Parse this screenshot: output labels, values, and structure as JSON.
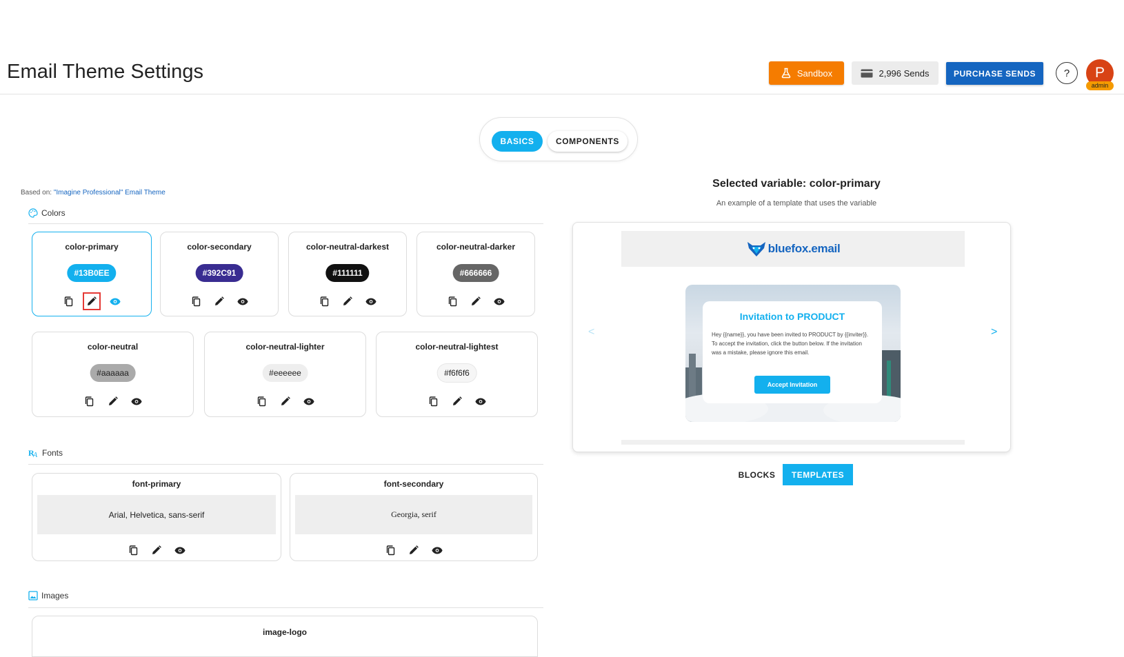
{
  "header": {
    "title": "Email Theme Settings",
    "sandbox_label": "Sandbox",
    "sends_label": "2,996 Sends",
    "purchase_label": "PURCHASE SENDS",
    "help_label": "?",
    "avatar_initial": "P",
    "role": "admin",
    "colors": {
      "sandbox": "#f57c00",
      "purchase": "#1565c0",
      "avatar": "#d84315"
    }
  },
  "tabs": [
    {
      "label": "BASICS",
      "active": true
    },
    {
      "label": "COMPONENTS",
      "active": false
    }
  ],
  "based_on": {
    "prefix": "Based on:",
    "theme": "\"Imagine Professional\" Email Theme"
  },
  "sections": {
    "colors": "Colors",
    "fonts": "Fonts",
    "images": "Images"
  },
  "color_vars": [
    {
      "name": "color-primary",
      "value": "#13B0EE",
      "bg": "#13B0EE",
      "fg": "#ffffff",
      "selected": true
    },
    {
      "name": "color-secondary",
      "value": "#392C91",
      "bg": "#392C91",
      "fg": "#ffffff",
      "selected": false
    },
    {
      "name": "color-neutral-darkest",
      "value": "#111111",
      "bg": "#111111",
      "fg": "#ffffff",
      "selected": false
    },
    {
      "name": "color-neutral-darker",
      "value": "#666666",
      "bg": "#666666",
      "fg": "#ffffff",
      "selected": false
    },
    {
      "name": "color-neutral",
      "value": "#aaaaaa",
      "bg": "#aaaaaa",
      "fg": "#222222",
      "selected": false
    },
    {
      "name": "color-neutral-lighter",
      "value": "#eeeeee",
      "bg": "#eeeeee",
      "fg": "#222222",
      "selected": false
    },
    {
      "name": "color-neutral-lightest",
      "value": "#f6f6f6",
      "bg": "#f6f6f6",
      "fg": "#222222",
      "selected": false
    }
  ],
  "font_vars": [
    {
      "name": "font-primary",
      "value": "Arial, Helvetica, sans-serif"
    },
    {
      "name": "font-secondary",
      "value": "Georgia, serif"
    }
  ],
  "image_vars": [
    {
      "name": "image-logo"
    }
  ],
  "icons": {
    "copy": "copy-icon",
    "edit": "pencil-icon",
    "view": "eye-icon"
  },
  "preview": {
    "selected_title": "Selected variable: color-primary",
    "subtitle": "An example of a template that uses the variable",
    "logo_text": "bluefox.email",
    "modal_title": "Invitation to PRODUCT",
    "modal_text": "Hey {{name}}, you have been invited to PRODUCT by {{inviter}}. To accept the invitation, click the button below. If the invitation was a mistake, please ignore this email.",
    "accept_label": "Accept Invitation",
    "prev_label": "<",
    "next_label": ">"
  },
  "toggle": [
    {
      "label": "BLOCKS",
      "active": false
    },
    {
      "label": "TEMPLATES",
      "active": true
    }
  ]
}
